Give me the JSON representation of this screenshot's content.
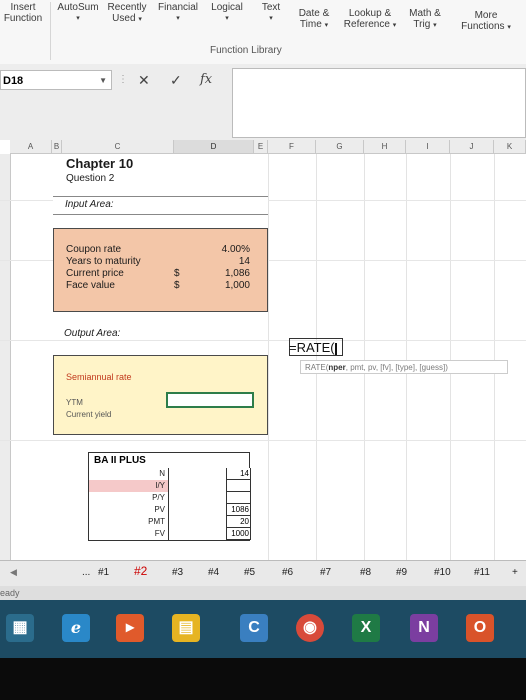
{
  "ribbon": {
    "buttons": [
      {
        "line1": "Insert",
        "line2": "Function"
      },
      {
        "line1": "AutoSum",
        "line2": ""
      },
      {
        "line1": "Recently",
        "line2": "Used"
      },
      {
        "line1": "Financial",
        "line2": ""
      },
      {
        "line1": "Logical",
        "line2": ""
      },
      {
        "line1": "Text",
        "line2": ""
      },
      {
        "line1": "Date &",
        "line2": "Time"
      },
      {
        "line1": "Lookup &",
        "line2": "Reference"
      },
      {
        "line1": "Math &",
        "line2": "Trig"
      },
      {
        "line1": "More",
        "line2": "Functions"
      }
    ],
    "group_label": "Function Library"
  },
  "formula_bar": {
    "name_box": "D18",
    "fx": "fx",
    "value": ""
  },
  "columns": [
    "A",
    "B",
    "C",
    "D",
    "E",
    "F",
    "G",
    "H",
    "I",
    "J",
    "K"
  ],
  "sheet": {
    "chapter": "Chapter 10",
    "question": "Question 2",
    "input_area_label": "Input Area:",
    "inputs": [
      {
        "label": "Coupon rate",
        "sym": "",
        "value": "4.00%"
      },
      {
        "label": "Years to maturity",
        "sym": "",
        "value": "14"
      },
      {
        "label": "Current price",
        "sym": "$",
        "value": "1,086"
      },
      {
        "label": "Face value",
        "sym": "$",
        "value": "1,000"
      }
    ],
    "output_area_label": "Output Area:",
    "semiannual_rate": "Semiannual rate",
    "ytm": "YTM",
    "current_yield": "Current yield",
    "formula_text": "=RATE(",
    "tooltip_fn": "RATE(",
    "tooltip_arg": "nper",
    "tooltip_rest": ", pmt, pv, [fv], [type], [guess])"
  },
  "calculator": {
    "title": "BA II PLUS",
    "rows": [
      {
        "label": "N",
        "value": "14"
      },
      {
        "label": "I/Y",
        "value": ""
      },
      {
        "label": "P/Y",
        "value": ""
      },
      {
        "label": "PV",
        "value": "1086"
      },
      {
        "label": "PMT",
        "value": "20"
      },
      {
        "label": "FV",
        "value": "1000"
      }
    ]
  },
  "tabs": [
    "#1",
    "#2",
    "#3",
    "#4",
    "#5",
    "#6",
    "#7",
    "#8",
    "#9",
    "#10",
    "#11"
  ],
  "tab_ellipsis": "...",
  "status": "eady",
  "colors": {
    "input_fill": "#f3c6a8",
    "output_fill": "#fff4c8",
    "active_cell_border": "#2e7d4a",
    "taskbar": "#1d4b63"
  },
  "taskbar_icons": [
    "windows-icon",
    "ie-icon",
    "media-icon",
    "files-icon",
    "edge-icon",
    "chrome-icon",
    "excel-icon",
    "onenote-icon",
    "office-icon"
  ]
}
